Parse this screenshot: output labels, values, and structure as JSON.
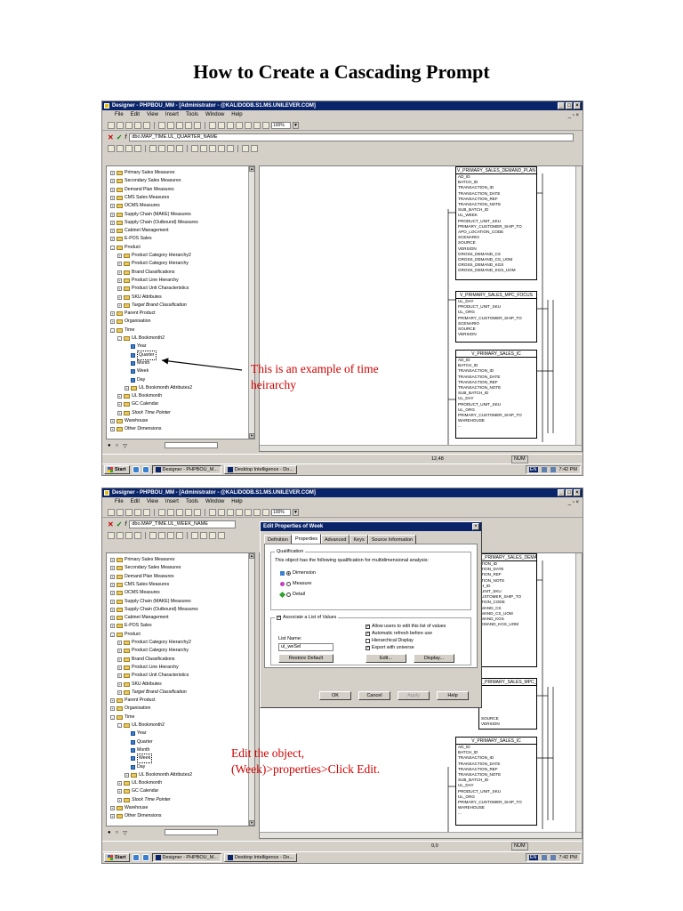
{
  "doc_title": "How to Create a Cascading Prompt",
  "app": {
    "title_1": "Designer - PHPBOU_MM - [Administrator - @KALIDODB.S1.MS.UNILEVER.COM]",
    "title_2": "Designer - PHPBOU_MM - [Administrator - @KALIDODB.S1.MS.UNILEVER.COM]",
    "menu": [
      "File",
      "Edit",
      "View",
      "Insert",
      "Tools",
      "Window",
      "Help"
    ],
    "zoom": "100%",
    "formula_1": "dbo.MAP_TIME.UL_QUARTER_NAME",
    "formula_2": "dbo.MAP_TIME.UL_WEEK_NAME"
  },
  "tree": {
    "items": [
      "Primary Sales Measures",
      "Secondary Sales Measures",
      "Demand Plan Measures",
      "CMS Sales Measures",
      "OCMS Measures",
      "Supply Chain (MAKE) Measures",
      "Supply Chain (Outbound) Measures",
      "Cabinet Management",
      "E-POS Sales",
      "Product",
      "Product Category Hierarchy2",
      "Product Category Hierarchy",
      "Brand Classifications",
      "Product Line Hierarchy",
      "Product Unit Characteristics",
      "SKU Attributes",
      "Target Brand Classification",
      "Parent Product",
      "Organisation",
      "Time",
      "UL Bookmonth2",
      "Year",
      "Quarter",
      "Month",
      "Week",
      "Day",
      "UL Bookmonth Attributes2",
      "UL Bookmonth",
      "GC Calendar",
      "Stock Time Pointer",
      "Warehouse",
      "Other Dimensions"
    ]
  },
  "tables": {
    "t1_name": "V_PRIMARY_SALES_DEMAND_PLAN",
    "t1_cols": [
      "AD_ID",
      "BATCH_ID",
      "TRANSACTION_ID",
      "TRANSACTION_DATE",
      "TRANSACTION_REF",
      "TRANSACTION_NOTE",
      "SUB_BATCH_ID",
      "UL_WEEK",
      "PRODUCT_UNIT_SKU",
      "PRIMARY_CUSTOMER_SHIP_TO",
      "APO_LOCATION_CODE",
      "SCENARIO",
      "SOURCE",
      "VERSION",
      "GROSS_DEMAND_CS",
      "GROSS_DEMAND_CS_UOM",
      "GROSS_DEMAND_KGS",
      "GROSS_DEMAND_KGS_UOM"
    ],
    "t2_name": "V_PRIMARY_SALES_MPC_FOCUS",
    "t2_cols": [
      "UL_DAY",
      "PRODUCT_UNIT_SKU",
      "UL_ORG",
      "PRIMARY_CUSTOMER_SHIP_TO",
      "SCENARIO",
      "SOURCE",
      "VERSION"
    ],
    "t3_name": "V_PRIMARY_SALES_IC",
    "t3_cols": [
      "AD_ID",
      "BATCH_ID",
      "TRANSACTION_ID",
      "TRANSACTION_DATE",
      "TRANSACTION_REF",
      "TRANSACTION_NOTE",
      "SUB_BATCH_ID",
      "UL_DAY",
      "PRODUCT_UNIT_SKU",
      "UL_ORG",
      "PRIMARY_CUSTOMER_SHIP_TO",
      "WAREHOUSE",
      "..."
    ],
    "t1b_cols": [
      "TION_ID",
      "TION_DATE",
      "TION_REF",
      "TION_NOTE",
      "H_ID",
      "",
      "UNIT_SKU",
      "USTOMER_SHIP_TO",
      "TION_CODE",
      "",
      "",
      "",
      "MAND_CS",
      "MAND_CS_UOM",
      "MAND_KGS",
      "EMAND_KGS_UOM"
    ]
  },
  "status": {
    "coords_1": "12,48",
    "coords_2": "0,0",
    "num": "NUM"
  },
  "taskbar": {
    "start": "Start",
    "task_1": "Designer - PHPBOU_M...",
    "task_2": "Desktop Intelligence - Do...",
    "lang": "EN",
    "clock": "7:42 PM"
  },
  "annotations": {
    "a1_line1": "This is an example of time",
    "a1_line2": "heirarchy",
    "a2_line1": "Edit the object,",
    "a2_line2": "(Week)>properties>Click Edit."
  },
  "dialog": {
    "title": "Edit Properties of Week",
    "tabs": [
      "Definition",
      "Properties",
      "Advanced",
      "Keys",
      "Source Information"
    ],
    "qualification_label": "Qualification",
    "qualification_desc": "This object has the following qualification for multidimensional analysis:",
    "qual_options": [
      "Dimension",
      "Measure",
      "Detail"
    ],
    "associate_label": "Associate a List of Values",
    "list_name_label": "List Name:",
    "list_name_value": "ul_weSel",
    "restore_default": "Restore Default",
    "lov_options": [
      "Allow users to edit this list of values",
      "Automatic refresh before use",
      "Hierarchical Display",
      "Export with universe"
    ],
    "edit_button": "Edit...",
    "display_button": "Display...",
    "ok": "OK",
    "cancel": "Cancel",
    "apply": "Apply",
    "help": "Help"
  },
  "colors": {
    "titlebar": "#0a246a",
    "annotation": "#d00000",
    "window": "#d4d0c8"
  }
}
